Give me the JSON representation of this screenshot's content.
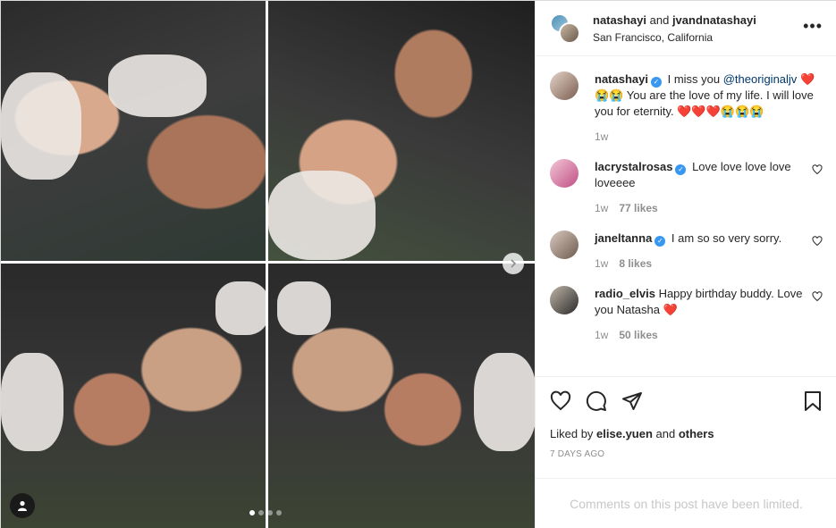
{
  "post": {
    "header": {
      "user1": "natashayi",
      "joiner": "and",
      "user2": "jvandnatashayi",
      "location": "San Francisco, California",
      "more_icon": "more-horizontal-icon"
    },
    "caption": {
      "username": "natashayi",
      "text_before_mention": "I miss you ",
      "mention": "@theoriginaljv",
      "line2": " You are the love of my life. I will love you for eternity. ",
      "emoji1": "❤️😭😭",
      "emoji2": "❤️❤️❤️😭😭😭",
      "time": "1w"
    },
    "comments": [
      {
        "username": "lacrystalrosas",
        "verified": true,
        "text": "Love love love love loveeee",
        "time": "1w",
        "likes": "77 likes",
        "avatar_colors": [
          "#f2c7d6",
          "#c04f84"
        ]
      },
      {
        "username": "janeltanna",
        "verified": true,
        "text": "I am so so very sorry.",
        "time": "1w",
        "likes": "8 likes",
        "avatar_colors": [
          "#d9c9bf",
          "#6e5a4e"
        ]
      },
      {
        "username": "radio_elvis",
        "verified": false,
        "text": "Happy birthday buddy. Love you Natasha ❤️",
        "time": "1w",
        "likes": "50 likes",
        "avatar_colors": [
          "#bfb5a8",
          "#2a2a2a"
        ]
      }
    ],
    "actions": {
      "like_icon": "heart-icon",
      "comment_icon": "comment-icon",
      "share_icon": "paper-plane-icon",
      "save_icon": "bookmark-icon"
    },
    "liked_by": {
      "prefix": "Liked by ",
      "user": "elise.yuen",
      "middle": " and ",
      "suffix": "others"
    },
    "date": "7 DAYS AGO",
    "comments_limited": "Comments on this post have been limited.",
    "carousel": {
      "slide_count": 4,
      "active_index": 0
    }
  },
  "colors": {
    "verified": "#3897f0",
    "heart": "#ed4956",
    "muted": "#8e8e8e",
    "mention": "#00376b"
  }
}
